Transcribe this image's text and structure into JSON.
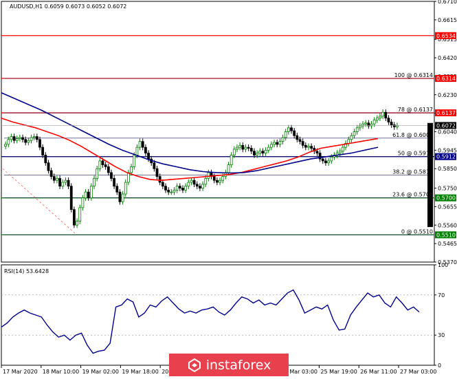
{
  "chart_data": [
    {
      "type": "candlestick",
      "title": "AUDUSD,H1  0.6059 0.6073 0.6052 0.6072",
      "ylim": [
        0.537,
        0.671
      ],
      "y_ticks": [
        "0.6710",
        "0.6615",
        "0.6515",
        "0.6420",
        "0.6325",
        "0.6230",
        "0.6135",
        "0.6040",
        "0.5945",
        "0.5850",
        "0.5750",
        "0.5655",
        "0.5560",
        "0.5465",
        "0.5370"
      ],
      "x_ticks": [
        "17 Mar 2020",
        "18 Mar 10:00",
        "19 Mar 02:00",
        "19 Mar 18:00",
        "20 Mar 10:00",
        "",
        "",
        "25 Mar 03:00",
        "25 Mar 19:00",
        "26 Mar 11:00",
        "27 Mar 03:00"
      ],
      "current_price": "0.6072",
      "horizontal_levels": [
        {
          "tag": "0.6534",
          "value": 0.6534,
          "color": "#ff0000"
        },
        {
          "tag": "0.6314",
          "value": 0.6314,
          "color": "#ff0000"
        },
        {
          "tag": "0.6137",
          "value": 0.6137,
          "color": "#ff0000"
        },
        {
          "tag": "0.5912",
          "value": 0.5912,
          "color": "#00008b"
        },
        {
          "tag": "0.5700",
          "value": 0.57,
          "color": "#008000"
        },
        {
          "tag": "0.5510",
          "value": 0.551,
          "color": "#008000"
        }
      ],
      "fib_levels": [
        {
          "label": "100 @ 0.6314",
          "value": 0.6314
        },
        {
          "label": "78 @ 0.6137",
          "value": 0.6137
        },
        {
          "label": "61.8 @ 0.6007",
          "value": 0.6007
        },
        {
          "label": "50 @ 0.5912",
          "value": 0.5912
        },
        {
          "label": "38.2 @ 0.5817",
          "value": 0.5817
        },
        {
          "label": "23.6 @ 0.5700",
          "value": 0.57
        },
        {
          "label": "0 @ 0.5510",
          "value": 0.551
        }
      ],
      "close_series": [
        0.5975,
        0.6,
        0.6015,
        0.5995,
        0.6005,
        0.601,
        0.6,
        0.5985,
        0.5995,
        0.601,
        0.6015,
        0.6,
        0.596,
        0.592,
        0.588,
        0.584,
        0.581,
        0.579,
        0.58,
        0.576,
        0.578,
        0.579,
        0.576,
        0.564,
        0.556,
        0.558,
        0.565,
        0.57,
        0.573,
        0.57,
        0.576,
        0.58,
        0.585,
        0.589,
        0.587,
        0.586,
        0.583,
        0.58,
        0.576,
        0.573,
        0.568,
        0.572,
        0.578,
        0.583,
        0.586,
        0.592,
        0.596,
        0.599,
        0.596,
        0.593,
        0.59,
        0.588,
        0.585,
        0.581,
        0.578,
        0.576,
        0.574,
        0.573,
        0.573,
        0.574,
        0.576,
        0.575,
        0.574,
        0.576,
        0.578,
        0.579,
        0.577,
        0.576,
        0.575,
        0.577,
        0.58,
        0.583,
        0.581,
        0.579,
        0.578,
        0.579,
        0.581,
        0.583,
        0.587,
        0.592,
        0.595,
        0.596,
        0.597,
        0.595,
        0.596,
        0.5955,
        0.594,
        0.592,
        0.593,
        0.594,
        0.593,
        0.5945,
        0.596,
        0.5975,
        0.5985,
        0.5975,
        0.599,
        0.601,
        0.604,
        0.606,
        0.6045,
        0.602,
        0.6,
        0.599,
        0.597,
        0.596,
        0.5965,
        0.5955,
        0.594,
        0.593,
        0.59,
        0.589,
        0.588,
        0.589,
        0.591,
        0.592,
        0.593,
        0.594,
        0.596,
        0.598,
        0.6,
        0.602,
        0.604,
        0.606,
        0.607,
        0.608,
        0.6085,
        0.607,
        0.608,
        0.61,
        0.611,
        0.612,
        0.614,
        0.611,
        0.609,
        0.6075,
        0.6065,
        0.6072
      ],
      "ma_series": [
        {
          "name": "",
          "color": "#ff0000",
          "values": [
            0.611,
            0.609,
            0.6075,
            0.606,
            0.604,
            0.602,
            0.5995,
            0.5965,
            0.593,
            0.5895,
            0.586,
            0.583,
            0.581,
            0.5795,
            0.579,
            0.5795,
            0.58,
            0.5805,
            0.581,
            0.5815,
            0.582,
            0.583,
            0.5845,
            0.586,
            0.5875,
            0.589,
            0.591,
            0.5935,
            0.5955,
            0.5965,
            0.5975,
            0.5985,
            0.5995,
            0.6005
          ]
        },
        {
          "name": "",
          "color": "#00008b",
          "values": [
            0.624,
            0.621,
            0.618,
            0.615,
            0.6115,
            0.608,
            0.6045,
            0.601,
            0.5975,
            0.5945,
            0.592,
            0.5895,
            0.5875,
            0.586,
            0.5845,
            0.5835,
            0.583,
            0.5828,
            0.583,
            0.584,
            0.5855,
            0.587,
            0.5885,
            0.59,
            0.591,
            0.592,
            0.593,
            0.5945,
            0.596
          ]
        }
      ]
    },
    {
      "type": "line",
      "title": "RSI(14) 53.6428",
      "ylim": [
        0,
        100
      ],
      "y_ticks": [
        "100",
        "70",
        "30",
        "0"
      ],
      "levels": [
        70,
        30
      ],
      "values": [
        38,
        42,
        48,
        52,
        55,
        52,
        50,
        48,
        40,
        33,
        28,
        30,
        25,
        30,
        32,
        20,
        12,
        14,
        15,
        22,
        58,
        60,
        66,
        63,
        48,
        52,
        60,
        58,
        64,
        68,
        62,
        56,
        52,
        54,
        52,
        55,
        56,
        58,
        53,
        50,
        55,
        62,
        68,
        66,
        62,
        65,
        60,
        62,
        60,
        66,
        72,
        75,
        65,
        52,
        55,
        58,
        56,
        60,
        45,
        35,
        36,
        50,
        58,
        65,
        72,
        68,
        70,
        62,
        58,
        68,
        62,
        55,
        58,
        53
      ]
    }
  ],
  "watermark": {
    "brand": "instaforex",
    "icon": "instaforex-logo-icon"
  },
  "colors": {
    "bull": "#008000",
    "bear": "#000000",
    "resistance": "#ff0000",
    "fib_mid": "#00008b",
    "support": "#008000",
    "rsi": "#00008b",
    "watermark_bg": "#e8404c"
  }
}
